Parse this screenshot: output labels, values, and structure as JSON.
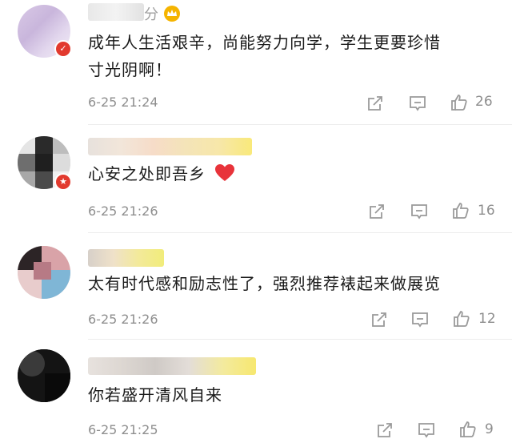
{
  "comments": [
    {
      "name_visible": "分",
      "text_line1": "成年人生活艰辛，尚能努力向学，学生更要珍惜",
      "text_line2": "寸光阴啊！",
      "time": "6-25 21:24",
      "likes": "26"
    },
    {
      "name_visible": "",
      "text": "心安之处即吾乡",
      "time": "6-25 21:26",
      "likes": "16"
    },
    {
      "name_visible": "",
      "text": "太有时代感和励志性了，强烈推荐裱起来做展览",
      "time": "6-25 21:26",
      "likes": "12"
    },
    {
      "name_visible": "",
      "text": "你若盛开清风自来",
      "time": "6-25 21:25",
      "likes": "9"
    }
  ],
  "colors": {
    "badge": "#e23a2e",
    "heart": "#e8333a",
    "crown": "#f5b400",
    "meta": "#8e8e8e"
  },
  "icons": [
    "share-icon",
    "comment-icon",
    "like-icon",
    "heart-emoji",
    "crown-icon",
    "official-badge-icon"
  ]
}
